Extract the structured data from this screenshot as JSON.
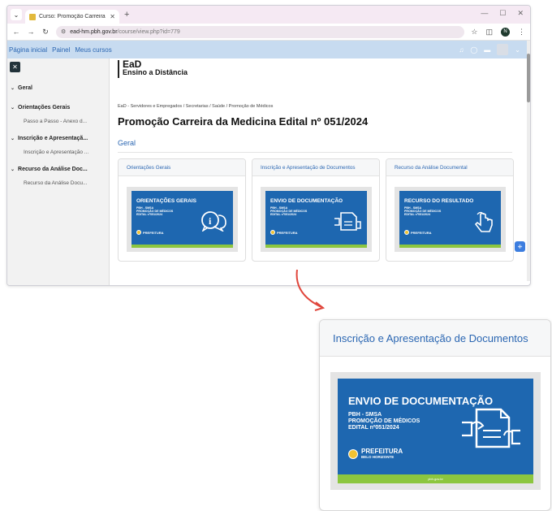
{
  "browser": {
    "tab_title": "Curso: Promoção Carreira da Me",
    "tab_close": "✕",
    "new_tab": "+",
    "win_controls": [
      "—",
      "☐",
      "✕"
    ],
    "url_host": "ead-hm.pbh.gov.br",
    "url_path": "/course/view.php?id=779",
    "profile_initial": "N"
  },
  "moodle_nav": {
    "items": [
      "Página inicial",
      "Painel",
      "Meus cursos"
    ]
  },
  "brand": {
    "line1": "EaD",
    "line2": "Ensino a Distância"
  },
  "sidebar": {
    "close_label": "✕",
    "sections": [
      {
        "title": "Geral",
        "items": []
      },
      {
        "title": "Orientações Gerais",
        "items": [
          "Passo a Passo - Anexo d..."
        ]
      },
      {
        "title": "Inscrição e Apresentaçã...",
        "items": [
          "Inscrição e Apresentação ..."
        ]
      },
      {
        "title": "Recurso da Análise Doc...",
        "items": [
          "Recurso da Análise Docu..."
        ]
      }
    ]
  },
  "breadcrumb": "EaD - Servidores e Empregados  /  Secretarias  /  Saúde  /  Promoção de Médicos",
  "page_title": "Promoção Carreira da Medicina Edital nº 051/2024",
  "section_title": "Geral",
  "cards": [
    {
      "header": "Orientações Gerais",
      "banner_title": "ORIENTAÇÕES GERAIS",
      "banner_lines": [
        "PBH - SMSA",
        "PROMOÇÃO DE MÉDICOS",
        "EDITAL nº051/2024"
      ],
      "logo": "PREFEITURA",
      "logo_sub": "BELO HORIZONTE",
      "icon": "info-chat-icon"
    },
    {
      "header": "Inscrição e Apresentação de Documentos",
      "banner_title": "ENVIO DE DOCUMENTAÇÃO",
      "banner_lines": [
        "PBH - SMSA",
        "PROMOÇÃO DE MÉDICOS",
        "EDITAL nº051/2024"
      ],
      "logo": "PREFEITURA",
      "logo_sub": "BELO HORIZONTE",
      "icon": "document-hand-icon"
    },
    {
      "header": "Recurso da Análise Documental",
      "banner_title": "RECURSO DO RESULTADO",
      "banner_lines": [
        "PBH - SMSA",
        "PROMOÇÃO DE MÉDICOS",
        "EDITAL nº051/2024"
      ],
      "logo": "PREFEITURA",
      "logo_sub": "BELO HORIZONTE",
      "icon": "pointer-hand-icon"
    }
  ],
  "zoom": {
    "header": "Inscrição e Apresentação de Documentos",
    "banner_title": "ENVIO DE DOCUMENTAÇÃO",
    "banner_lines": [
      "PBH - SMSA",
      "PROMOÇÃO DE MÉDICOS",
      "EDITAL nº051/2024"
    ],
    "logo": "PREFEITURA",
    "logo_sub": "BELO HORIZONTE",
    "footer": "pbh.gov.br"
  },
  "colors": {
    "accent": "#2a66b2",
    "banner": "#1e67b0",
    "banner_foot": "#8cc63f",
    "arrow": "#e0463c"
  }
}
